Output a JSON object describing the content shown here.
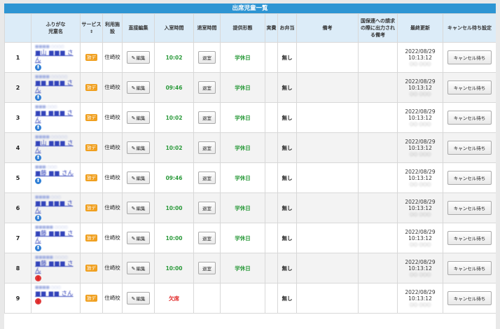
{
  "page_title": "出席児童一覧",
  "headers": {
    "no": "",
    "name": "ふりがな\n児童名",
    "service": "サービス",
    "facility": "利用施設",
    "direct_edit": "直接編集",
    "entry_time": "入室時間",
    "exit_time": "退室時間",
    "provision": "提供形態",
    "actual_cost": "実費",
    "lunch": "お弁当",
    "remarks": "備考",
    "billing_remarks": "国保連への請求の際に出力される備考",
    "last_update": "最終更新",
    "cancel_setting": "キャンセル待ち設定"
  },
  "labels": {
    "edit_button": "編集",
    "exit_button": "退室",
    "cancel_button": "キャンセル待ち",
    "san": "さん"
  },
  "colors": {
    "header_bar": "#2e95d3",
    "header_row": "#dcecf8",
    "service_badge": "#f0a020",
    "time_green": "#2a9a3a",
    "absent_red": "#e02020",
    "gender_blue": "#2f7fd6",
    "gender_red": "#e03b3b"
  },
  "rows": [
    {
      "no": "1",
      "furigana": "■■■■ ○○○○",
      "name": "■山 ■■■ さん",
      "gender": "blue",
      "service": "放デ",
      "facility": "住崎校",
      "entry": "10:02",
      "entry_status": "time",
      "exit_btn": true,
      "provision": "学休日",
      "actual": "",
      "lunch": "無し",
      "remarks": "",
      "billing": "",
      "updated_date": "2022/08/29",
      "updated_time": "10:13:12",
      "updater": "○○ ○○○"
    },
    {
      "no": "2",
      "furigana": "■■■■ ○○○○○",
      "name": "■■ ■■■ さん",
      "gender": "blue",
      "service": "放デ",
      "facility": "住崎校",
      "entry": "09:46",
      "entry_status": "time",
      "exit_btn": true,
      "provision": "学休日",
      "actual": "",
      "lunch": "無し",
      "remarks": "",
      "billing": "",
      "updated_date": "2022/08/29",
      "updated_time": "10:13:12",
      "updater": "○○ ○○○"
    },
    {
      "no": "3",
      "furigana": "■■■ ○○○",
      "name": "■■ ■■■ さん",
      "gender": "blue",
      "service": "放デ",
      "facility": "住崎校",
      "entry": "10:02",
      "entry_status": "time",
      "exit_btn": true,
      "provision": "学休日",
      "actual": "",
      "lunch": "無し",
      "remarks": "",
      "billing": "",
      "updated_date": "2022/08/29",
      "updated_time": "10:13:12",
      "updater": "○○ ○○○"
    },
    {
      "no": "4",
      "furigana": "■■■■ ○○○○○",
      "name": "■山 ■■■ さん",
      "gender": "blue",
      "service": "放デ",
      "facility": "住崎校",
      "entry": "10:02",
      "entry_status": "time",
      "exit_btn": true,
      "provision": "学休日",
      "actual": "",
      "lunch": "無し",
      "remarks": "",
      "billing": "",
      "updated_date": "2022/08/29",
      "updated_time": "10:13:12",
      "updater": "○○ ○○○"
    },
    {
      "no": "5",
      "furigana": "■■■ ○○○",
      "name": "■藤 ■■ さん",
      "gender": "blue",
      "service": "放デ",
      "facility": "住崎校",
      "entry": "09:46",
      "entry_status": "time",
      "exit_btn": true,
      "provision": "学休日",
      "actual": "",
      "lunch": "無し",
      "remarks": "",
      "billing": "",
      "updated_date": "2022/08/29",
      "updated_time": "10:13:12",
      "updater": "○○ ○○○"
    },
    {
      "no": "6",
      "furigana": "■■■■ ○○○",
      "name": "■■ ■■■ さん",
      "gender": "blue",
      "service": "放デ",
      "facility": "住崎校",
      "entry": "10:00",
      "entry_status": "time",
      "exit_btn": true,
      "provision": "学休日",
      "actual": "",
      "lunch": "無し",
      "remarks": "",
      "billing": "",
      "updated_date": "2022/08/29",
      "updated_time": "10:13:12",
      "updater": "○○ ○○○"
    },
    {
      "no": "7",
      "furigana": "■■■■■ ○○○○",
      "name": "■藤 ■■■ さん",
      "gender": "blue",
      "service": "放デ",
      "facility": "住崎校",
      "entry": "10:00",
      "entry_status": "time",
      "exit_btn": true,
      "provision": "学休日",
      "actual": "",
      "lunch": "無し",
      "remarks": "",
      "billing": "",
      "updated_date": "2022/08/29",
      "updated_time": "10:13:12",
      "updater": "○○ ○○○"
    },
    {
      "no": "8",
      "furigana": "■■■■■ ○○○○",
      "name": "■藤 ■■■ さん",
      "gender": "red",
      "service": "放デ",
      "facility": "住崎校",
      "entry": "10:00",
      "entry_status": "time",
      "exit_btn": true,
      "provision": "学休日",
      "actual": "",
      "lunch": "無し",
      "remarks": "",
      "billing": "",
      "updated_date": "2022/08/29",
      "updated_time": "10:13:12",
      "updater": "○○ ○○○"
    },
    {
      "no": "9",
      "furigana": "■■■■ ○○○",
      "name": "■■ ■■ さん",
      "gender": "red",
      "service": "放デ",
      "facility": "住崎校",
      "entry": "欠席",
      "entry_status": "absent",
      "exit_btn": false,
      "provision": "",
      "actual": "",
      "lunch": "無し",
      "remarks": "",
      "billing": "",
      "updated_date": "2022/08/29",
      "updated_time": "10:13:12",
      "updater": "○○ ○○○"
    }
  ]
}
